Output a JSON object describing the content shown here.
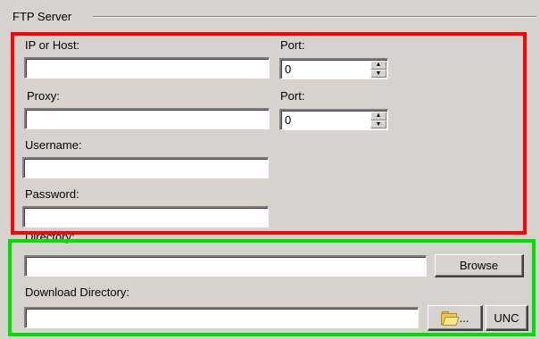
{
  "group": {
    "title": "FTP Server"
  },
  "fields": {
    "host_label": "IP or Host:",
    "host_value": "",
    "port_label": "Port:",
    "port_value": "0",
    "proxy_label": "Proxy:",
    "proxy_value": "",
    "proxy_port_label": "Port:",
    "proxy_port_value": "0",
    "username_label": "Username:",
    "username_value": "",
    "password_label": "Password:",
    "password_value": ""
  },
  "directory": {
    "label": "Directory:",
    "value": "",
    "browse_label": "Browse",
    "download_label": "Download Directory:",
    "download_value": "",
    "folder_button_text": "...",
    "unc_label": "UNC"
  },
  "icons": {
    "folder": "folder-open-icon",
    "spin_up": "spin-up-icon",
    "spin_down": "spin-down-icon"
  },
  "colors": {
    "highlight_red": "#ff0000",
    "highlight_green": "#00e000",
    "window_bg": "#d6d3ce"
  }
}
